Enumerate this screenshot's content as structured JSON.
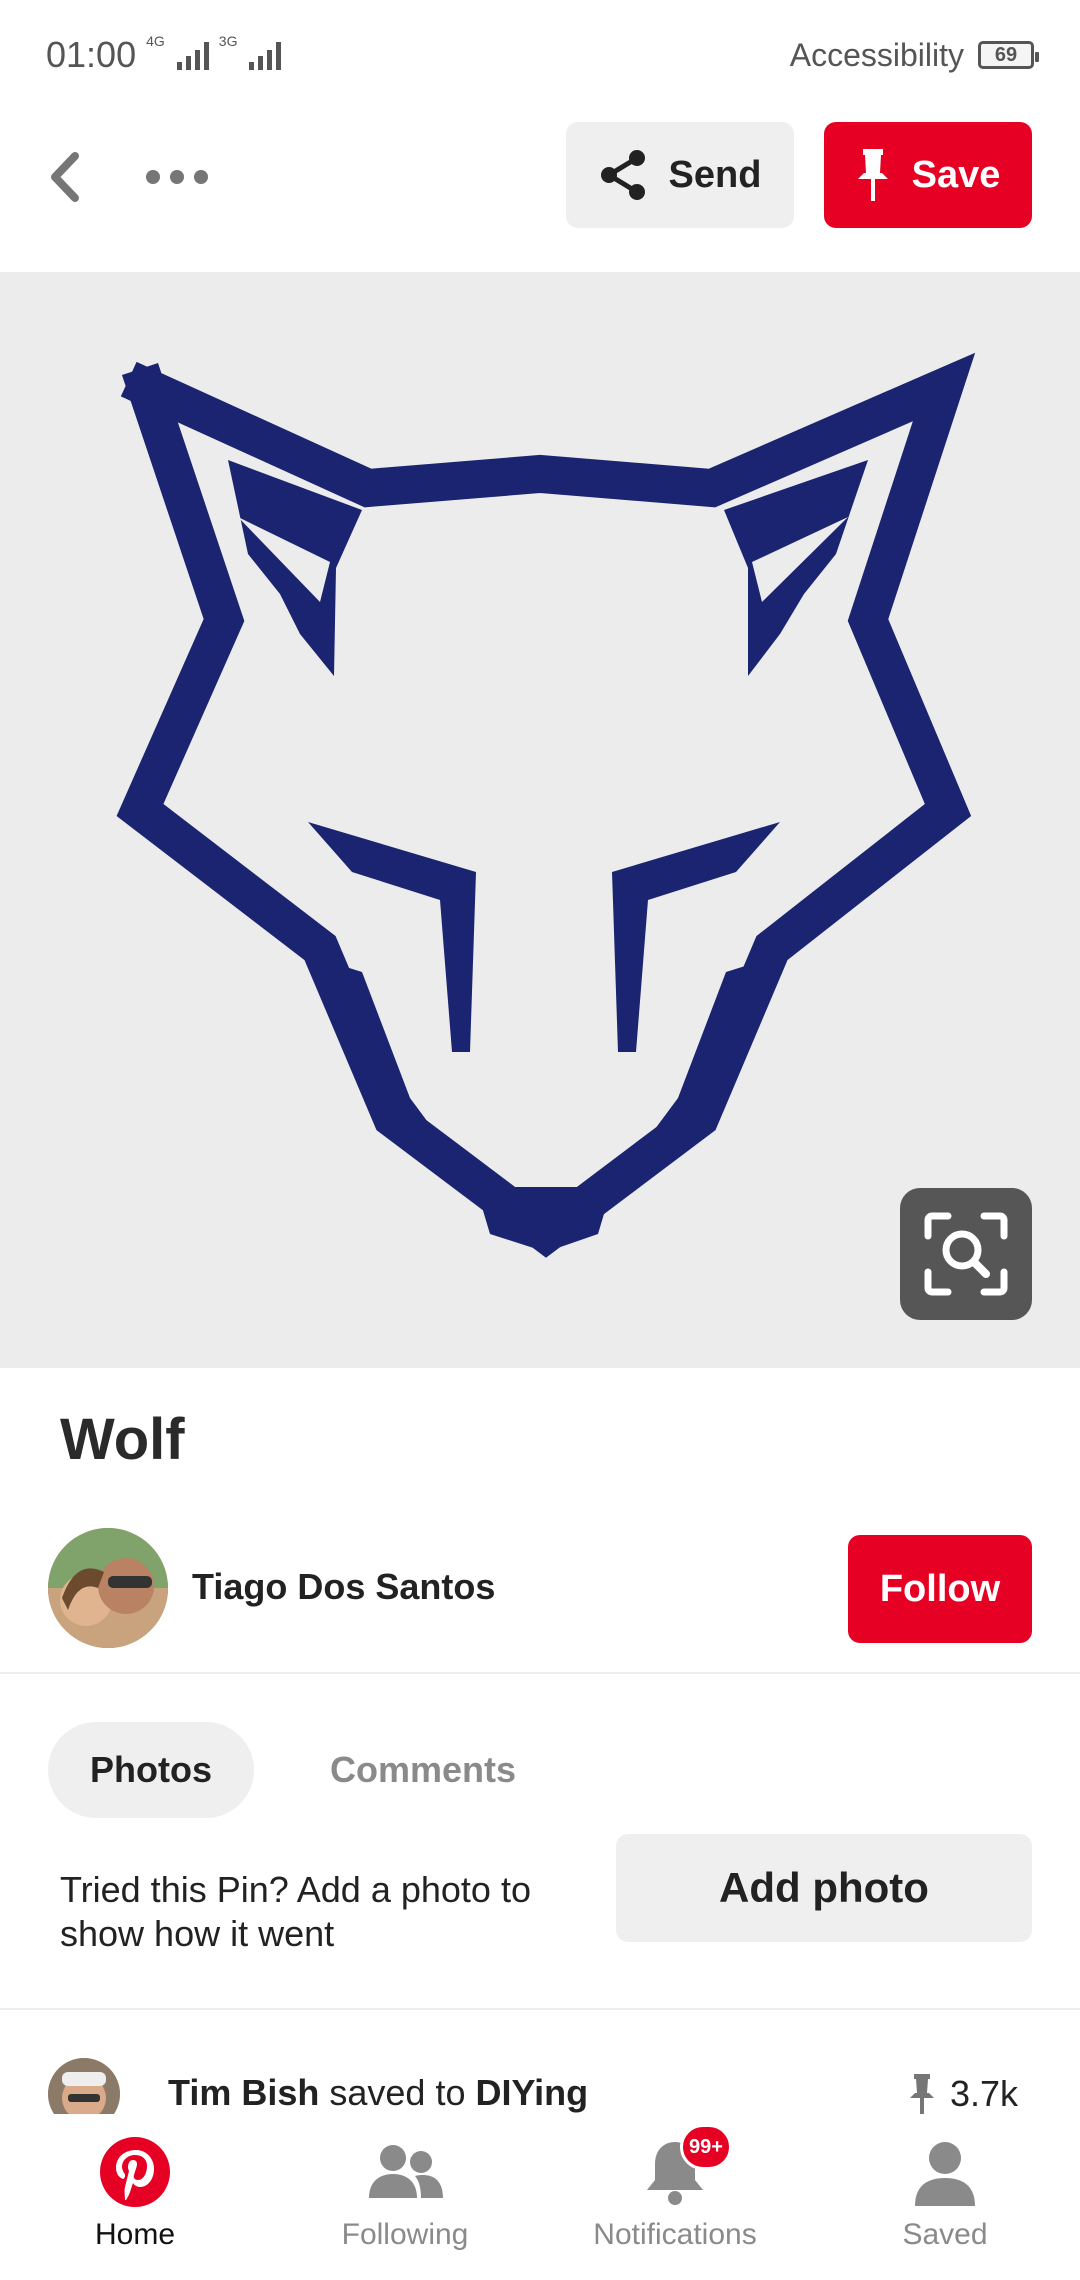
{
  "status_bar": {
    "time": "01:00",
    "net_tag_1": "4G",
    "net_tag_2": "3G",
    "accessibility_label": "Accessibility",
    "battery_level": "69"
  },
  "topbar": {
    "send_label": "Send",
    "save_label": "Save"
  },
  "pin": {
    "title": "Wolf",
    "logo_color": "#1a2470",
    "background_color": "#ececec"
  },
  "author": {
    "name": "Tiago Dos Santos",
    "follow_label": "Follow"
  },
  "tabs": [
    {
      "label": "Photos",
      "active": true
    },
    {
      "label": "Comments",
      "active": false
    }
  ],
  "tried": {
    "text": "Tried this Pin? Add a photo to show how it went",
    "button_label": "Add photo"
  },
  "activity": {
    "user": "Tim Bish",
    "action": "saved to",
    "board": "DIYing",
    "save_count": "3.7k"
  },
  "bottom_nav": {
    "items": [
      {
        "label": "Home",
        "icon": "pinterest-logo-icon",
        "active": true
      },
      {
        "label": "Following",
        "icon": "people-icon",
        "active": false
      },
      {
        "label": "Notifications",
        "icon": "bell-icon",
        "active": false,
        "badge": "99+"
      },
      {
        "label": "Saved",
        "icon": "person-icon",
        "active": false
      }
    ]
  },
  "colors": {
    "brand_red": "#e60023",
    "button_gray": "#efefef",
    "text_dark": "#222222",
    "text_muted": "#8a8a8a"
  }
}
